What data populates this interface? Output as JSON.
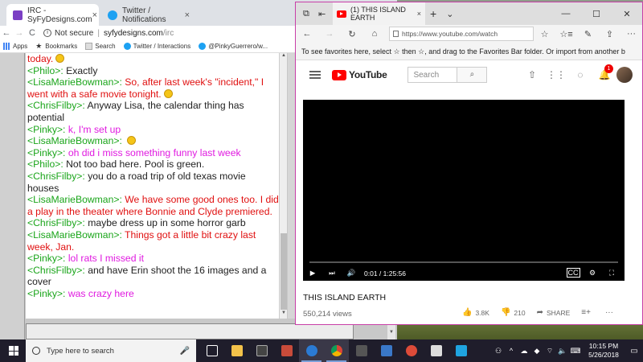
{
  "chrome": {
    "tabs": [
      {
        "label": "IRC - SyFyDesigns.com",
        "close": "×"
      },
      {
        "label": "Twitter / Notifications",
        "close": "×"
      }
    ],
    "nav": {
      "back": "←",
      "forward": "→",
      "reload": "C"
    },
    "address": {
      "security": "Not secure",
      "host": "syfydesigns.com",
      "path": "/irc"
    },
    "bookmarks": [
      "Apps",
      "Bookmarks",
      "Search",
      "Twitter / Interactions",
      "@PinkyGuerrero/w..."
    ]
  },
  "chat": {
    "messages": [
      {
        "nick": "",
        "text": "today.",
        "color": "red",
        "emoji": true
      },
      {
        "nick": "<Philo>:",
        "text": "Exactly",
        "color": "black"
      },
      {
        "nick": "<LisaMarieBowman>:",
        "text": "So, after last week's \"incident,\" I went with a safe movie tonight.",
        "color": "red",
        "emoji": true
      },
      {
        "nick": "<ChrisFilby>:",
        "text": "Anyway Lisa, the calendar thing has potential",
        "color": "black"
      },
      {
        "nick": "<Pinky>:",
        "text": "k, I'm set up",
        "color": "magenta"
      },
      {
        "nick": "<LisaMarieBowman>:",
        "text": "",
        "color": "red",
        "emoji": true
      },
      {
        "nick": "<Pinky>:",
        "text": "oh did i miss something funny last week",
        "color": "magenta"
      },
      {
        "nick": "<Philo>:",
        "text": "Not too bad here. Pool is green.",
        "color": "black"
      },
      {
        "nick": "<ChrisFilby>:",
        "text": "you do a road trip of old texas movie houses",
        "color": "black"
      },
      {
        "nick": "<LisaMarieBowman>:",
        "text": "We have some good ones too.  I did a play in the theater where Bonnie and Clyde premiered.",
        "color": "red"
      },
      {
        "nick": "<ChrisFilby>:",
        "text": "maybe dress up in some horror garb",
        "color": "black"
      },
      {
        "nick": "<LisaMarieBowman>:",
        "text": "Things got a little bit crazy last week, Jan.",
        "color": "red"
      },
      {
        "nick": "<Pinky>:",
        "text": "lol rats I missed it",
        "color": "magenta"
      },
      {
        "nick": "<ChrisFilby>:",
        "text": "and have Erin shoot the 16 images and a cover",
        "color": "black"
      },
      {
        "nick": "<Pinky>:",
        "text": "was crazy here",
        "color": "magenta"
      }
    ],
    "input_value": ""
  },
  "edge": {
    "tab": {
      "label": "(1) THIS ISLAND EARTH",
      "close": "×"
    },
    "titlebar_icons": {
      "new_tab": "+",
      "tab_list": "⌄"
    },
    "window": {
      "minimize": "—",
      "maximize": "☐",
      "close": "✕"
    },
    "nav": {
      "back": "←",
      "forward": "→",
      "refresh": "↻",
      "home": "⌂"
    },
    "url": "https://www.youtube.com/watch",
    "toolbar_icons": [
      "☆",
      "☆≡",
      "✎",
      "⇪",
      "···"
    ],
    "favorites_bar_text": "To see favorites here, select  ☆  then ☆, and drag to the Favorites Bar folder. Or import from another b"
  },
  "youtube": {
    "logo": "YouTube",
    "search_placeholder": "Search",
    "notification_count": "1",
    "player": {
      "time": "0:01 / 1:25:56",
      "cc": "CC"
    },
    "video_title": "THIS ISLAND EARTH",
    "views": "550,214 views",
    "likes": "3.8K",
    "dislikes": "210",
    "share": "SHARE"
  },
  "taskbar": {
    "search_placeholder": "Type here to search",
    "time": "10:15 PM",
    "date": "5/26/2018"
  }
}
